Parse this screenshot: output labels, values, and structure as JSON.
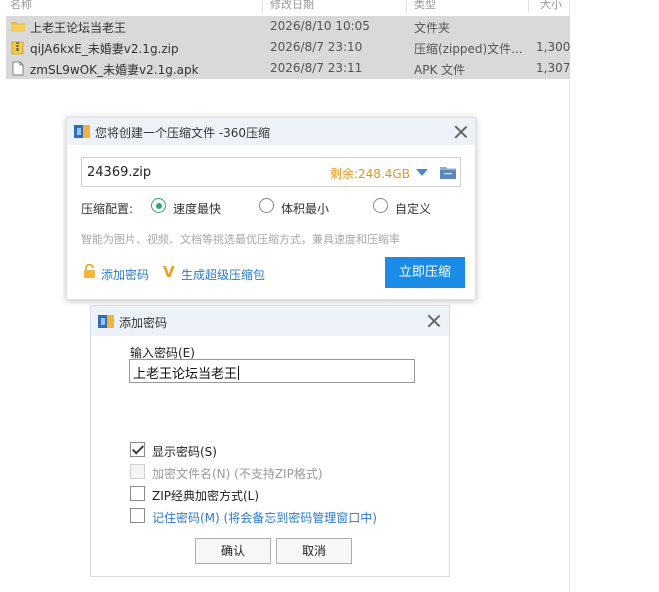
{
  "explorer": {
    "header": [
      "名称",
      "修改日期",
      "类型",
      "大小"
    ],
    "files": [
      {
        "name": "上老王论坛当老王",
        "date": "2026/8/10 10:05",
        "type": "文件夹",
        "size": "",
        "icon": "folder-icon"
      },
      {
        "name": "qiJA6kxE_未婚妻v2.1g.zip",
        "date": "2026/8/7 23:10",
        "type": "压缩(zipped)文件...",
        "size": "1,300",
        "icon": "zip-file-icon"
      },
      {
        "name": "zmSL9wOK_未婚妻v2.1g.apk",
        "date": "2026/8/7 23:11",
        "type": "APK 文件",
        "size": "1,307",
        "icon": "apk-file-icon"
      }
    ]
  },
  "compress_dialog": {
    "title": "您将创建一个压缩文件 -360压缩",
    "file_name": "24369.zip",
    "free_space": "剩余:248.4GB",
    "config_label": "压缩配置:",
    "options": [
      "速度最快",
      "体积最小",
      "自定义"
    ],
    "selected_option": "速度最快",
    "hint": "智能为图片、视频、文档等挑选最优压缩方式，兼具速度和压缩率",
    "add_password": "添加密码",
    "super_compress": "生成超级压缩包",
    "start_button": "立即压缩"
  },
  "password_dialog": {
    "title": "添加密码",
    "input_label": "输入密码(E)",
    "password_value": "上老王论坛当老王",
    "checkboxes": [
      {
        "label": "显示密码(S)",
        "checked": true,
        "disabled": false
      },
      {
        "label": "加密文件名(N) (不支持ZIP格式)",
        "checked": false,
        "disabled": true
      },
      {
        "label": "ZIP经典加密方式(L)",
        "checked": false,
        "disabled": false
      },
      {
        "label": "记住密码(M) (将会备忘到密码管理窗口中)",
        "checked": false,
        "disabled": false
      }
    ],
    "ok_button": "确认",
    "cancel_button": "取消"
  },
  "colors": {
    "accent_blue": "#1a8ce8",
    "link_blue": "#2a7bd4",
    "free_space_orange": "#e69422",
    "radio_green": "#2ca86a",
    "title_bar": "#edf2f9"
  }
}
